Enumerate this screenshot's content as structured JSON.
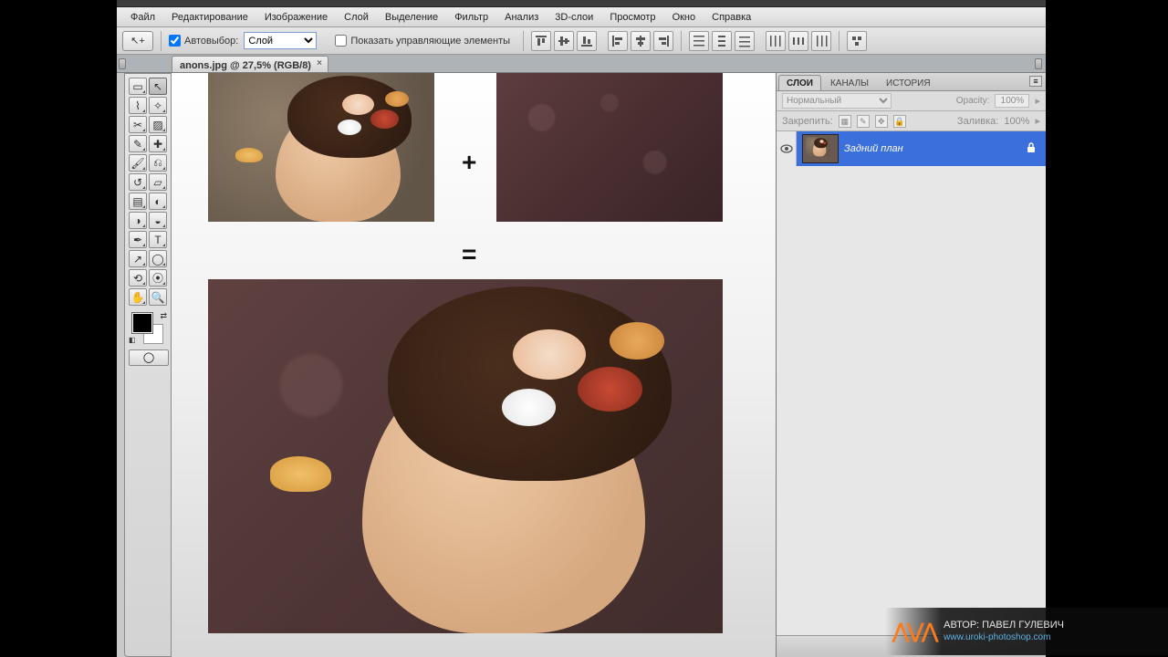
{
  "menu": [
    "Файл",
    "Редактирование",
    "Изображение",
    "Слой",
    "Выделение",
    "Фильтр",
    "Анализ",
    "3D-слои",
    "Просмотр",
    "Окно",
    "Справка"
  ],
  "options": {
    "tool_icon": "↖+",
    "auto_select_label": "Автовыбор:",
    "auto_select_checked": true,
    "layer_scope": "Слой",
    "show_controls_label": "Показать управляющие элементы",
    "show_controls_checked": false
  },
  "doc_tab": {
    "title": "anons.jpg @ 27,5% (RGB/8)",
    "close": "×"
  },
  "tools_grid": [
    [
      "rect-marquee",
      "move"
    ],
    [
      "lasso",
      "magic-wand"
    ],
    [
      "crop",
      "slice"
    ],
    [
      "eyedropper",
      "patch"
    ],
    [
      "brush",
      "pencil"
    ],
    [
      "clone",
      "history-brush"
    ],
    [
      "eraser",
      "gradient"
    ],
    [
      "blur",
      "dodge"
    ],
    [
      "pen",
      "type"
    ],
    [
      "path-sel",
      "shape"
    ],
    [
      "3d-rotate",
      "3d-orbit"
    ],
    [
      "hand",
      "zoom"
    ]
  ],
  "canvas": {
    "plus": "+",
    "equals": "="
  },
  "panels": {
    "tabs": [
      "СЛОИ",
      "КАНАЛЫ",
      "ИСТОРИЯ"
    ],
    "active_tab": 0,
    "blend_mode": "Нормальный",
    "opacity_label": "Opacity:",
    "opacity_value": "100%",
    "lock_label": "Закрепить:",
    "fill_label": "Заливка:",
    "fill_value": "100%",
    "layer_name": "Задний план"
  },
  "watermark": {
    "author_label": "АВТОР: ПАВЕЛ ГУЛЕВИЧ",
    "url": "www.uroki-photoshop.com"
  }
}
